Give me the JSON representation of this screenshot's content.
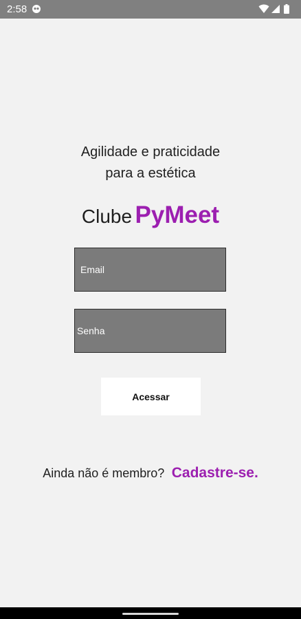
{
  "status_bar": {
    "time": "2:58",
    "icons": [
      "notification-icon",
      "wifi-icon",
      "signal-icon",
      "battery-icon"
    ]
  },
  "tagline": {
    "line1": "Agilidade e praticidade",
    "line2": "para a estética"
  },
  "brand": {
    "prefix": "Clube",
    "name": "PyMeet"
  },
  "form": {
    "email_placeholder": "Email",
    "password_placeholder": "Senha",
    "submit_label": "Acessar"
  },
  "signup": {
    "prompt": "Ainda não é membro?",
    "link_label": "Cadastre-se."
  },
  "colors": {
    "accent": "#9c1fb0",
    "background": "#f2f2f2",
    "field_background": "#7b7b7b",
    "status_bar": "#808080"
  }
}
